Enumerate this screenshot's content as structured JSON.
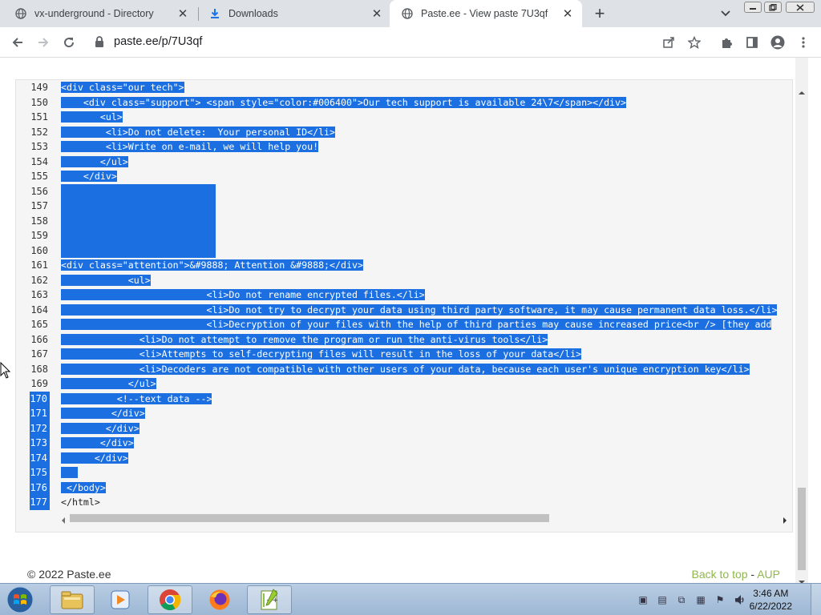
{
  "browser": {
    "tabs": [
      {
        "title": "vx-underground - Directory",
        "icon": "globe-icon"
      },
      {
        "title": "Downloads",
        "icon": "download-icon"
      },
      {
        "title": "Paste.ee - View paste 7U3qf",
        "icon": "globe-icon",
        "active": true
      }
    ],
    "url": "paste.ee/p/7U3qf"
  },
  "code": {
    "lines": [
      {
        "n": "149",
        "text": "<div class=\"our tech\">",
        "sel": true
      },
      {
        "n": "150",
        "text": "    <div class=\"support\"> <span style=\"color:#006400\">Our tech support is available 24\\7</span></div>",
        "sel": true
      },
      {
        "n": "151",
        "text": "       <ul>",
        "sel": true
      },
      {
        "n": "152",
        "text": "        <li>Do not delete:  Your personal ID</li>",
        "sel": true
      },
      {
        "n": "153",
        "text": "        <li>Write on e-mail, we will help you!",
        "sel": true
      },
      {
        "n": "154",
        "text": "       </ul>",
        "sel": true
      },
      {
        "n": "155",
        "text": "    </div>",
        "sel": true
      },
      {
        "n": "156",
        "text": "",
        "sel": true,
        "blank": true
      },
      {
        "n": "157",
        "text": "",
        "sel": true,
        "blank": true
      },
      {
        "n": "158",
        "text": "",
        "sel": true,
        "blank": true
      },
      {
        "n": "159",
        "text": "",
        "sel": true,
        "blank": true
      },
      {
        "n": "160",
        "text": "",
        "sel": true,
        "blank": true
      },
      {
        "n": "161",
        "text": "<div class=\"attention\">&#9888; Attention &#9888;</div>",
        "sel": true
      },
      {
        "n": "162",
        "text": "            <ul>",
        "sel": true
      },
      {
        "n": "163",
        "text": "                          <li>Do not rename encrypted files.</li>",
        "sel": true
      },
      {
        "n": "164",
        "text": "                          <li>Do not try to decrypt your data using third party software, it may cause permanent data loss.</li>",
        "sel": true
      },
      {
        "n": "165",
        "text": "                          <li>Decryption of your files with the help of third parties may cause increased price<br /> [they add",
        "sel": true
      },
      {
        "n": "166",
        "text": "              <li>Do not attempt to remove the program or run the anti-virus tools</li>",
        "sel": true
      },
      {
        "n": "167",
        "text": "              <li>Attempts to self-decrypting files will result in the loss of your data</li>",
        "sel": true
      },
      {
        "n": "168",
        "text": "              <li>Decoders are not compatible with other users of your data, because each user's unique encryption key</li>",
        "sel": true
      },
      {
        "n": "169",
        "text": "            </ul>",
        "sel": true
      },
      {
        "n": "170",
        "text": "          <!--text data -->",
        "sel": true,
        "lnsel": true
      },
      {
        "n": "171",
        "text": "         </div>",
        "sel": true,
        "lnsel": true
      },
      {
        "n": "172",
        "text": "        </div>",
        "sel": true,
        "lnsel": true
      },
      {
        "n": "173",
        "text": "       </div>",
        "sel": true,
        "lnsel": true
      },
      {
        "n": "174",
        "text": "      </div>",
        "sel": true,
        "lnsel": true
      },
      {
        "n": "175",
        "text": "   ",
        "sel": true,
        "lnsel": true
      },
      {
        "n": "176",
        "text": " </body>",
        "sel": true,
        "lnsel": true
      },
      {
        "n": "177",
        "text": "</html>",
        "sel": false,
        "lnsel": true
      }
    ]
  },
  "footer": {
    "copyright": "© 2022 Paste.ee",
    "back_to_top": "Back to top",
    "separator": " - ",
    "aup": "AUP"
  },
  "taskbar": {
    "time": "3:46 AM",
    "date": "6/22/2022"
  },
  "colors": {
    "selection": "#1b6fe0",
    "footer_link": "#8fb84a"
  }
}
